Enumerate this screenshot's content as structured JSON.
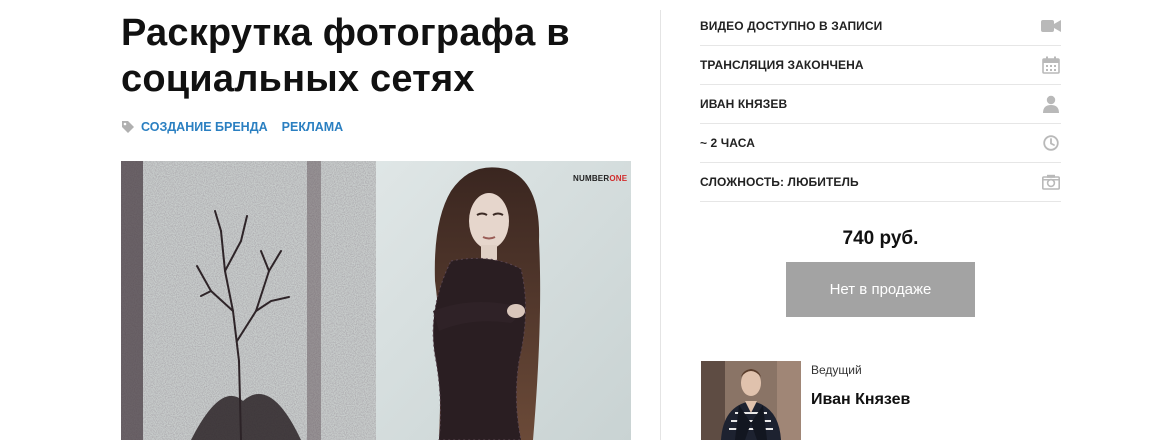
{
  "course": {
    "title": "Раскрутка фотографа в социальных сетях",
    "tags": [
      "СОЗДАНИЕ БРЕНДА",
      "РЕКЛАМА"
    ],
    "cover": {
      "logo_prefix": "NUMBER",
      "logo_suffix": "ONE"
    }
  },
  "info": [
    {
      "text": "ВИДЕО ДОСТУПНО В ЗАПИСИ",
      "icon": "video-camera-icon"
    },
    {
      "text": "ТРАНСЛЯЦИЯ ЗАКОНЧЕНА",
      "icon": "calendar-icon"
    },
    {
      "text": "ИВАН КНЯЗЕВ",
      "icon": "user-icon"
    },
    {
      "text": "~ 2 ЧАСА",
      "icon": "clock-icon"
    },
    {
      "text": "СЛОЖНОСТЬ: ЛЮБИТЕЛЬ",
      "icon": "camera-icon"
    }
  ],
  "purchase": {
    "price": "740 руб.",
    "button_label": "Нет в продаже"
  },
  "host": {
    "label": "Ведущий",
    "name": "Иван Князев"
  },
  "colors": {
    "tag_link": "#2a7fc1",
    "button_disabled": "#a3a3a3",
    "icon": "#b9b9b9",
    "divider": "#e4e4e4"
  }
}
